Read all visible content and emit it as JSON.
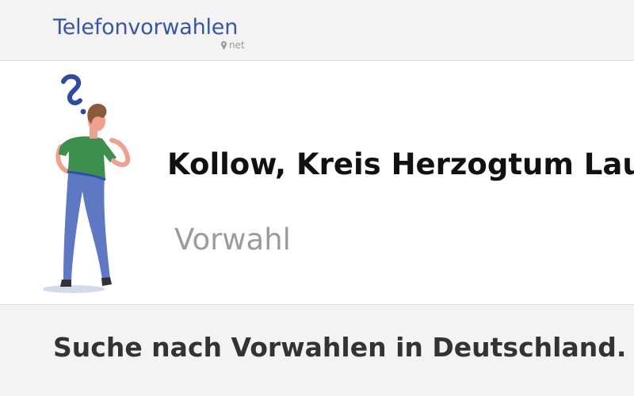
{
  "header": {
    "logo_text": "Telefonvorwahlen",
    "logo_suffix": "net",
    "pin_icon": "map-pin-icon"
  },
  "hero": {
    "illustration": "thinking-person-with-question-mark",
    "title": "Kollow, Kreis Herzogtum Lauenburg",
    "subtitle": "Vorwahl"
  },
  "main": {
    "search_heading": "Suche nach Vorwahlen in Deutschland."
  },
  "colors": {
    "brand_blue": "#3a55a3",
    "shirt_green": "#3e8e4e",
    "pants_blue": "#5f78c4",
    "muted_gray": "#9b9b9b"
  }
}
